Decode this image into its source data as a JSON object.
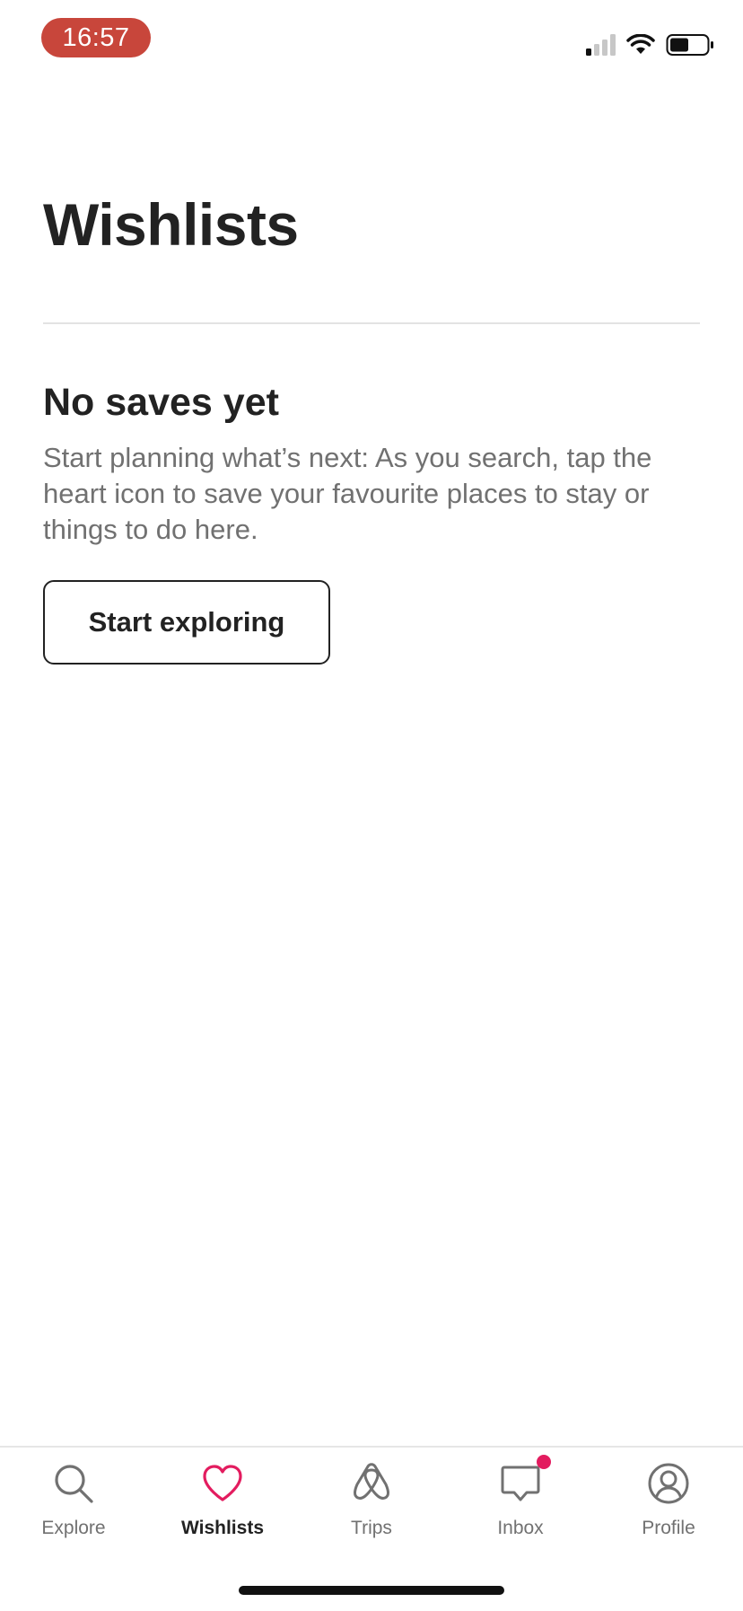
{
  "status_bar": {
    "time": "16:57",
    "icons": [
      "signal-icon",
      "wifi-icon",
      "battery-icon"
    ]
  },
  "header": {
    "title": "Wishlists"
  },
  "empty_state": {
    "heading": "No saves yet",
    "body": "Start planning what’s next: As you search, tap the heart icon to save your favourite places to stay or things to do here.",
    "button_label": "Start exploring"
  },
  "tab_bar": {
    "tabs": [
      {
        "label": "Explore",
        "icon": "search-icon",
        "active": false
      },
      {
        "label": "Wishlists",
        "icon": "heart-icon",
        "active": true
      },
      {
        "label": "Trips",
        "icon": "airbnb-logo-icon",
        "active": false
      },
      {
        "label": "Inbox",
        "icon": "message-icon",
        "active": false,
        "notification": true
      },
      {
        "label": "Profile",
        "icon": "profile-icon",
        "active": false
      }
    ]
  },
  "colors": {
    "accent": "#e31c5f",
    "text_primary": "#222222",
    "text_secondary": "#717171",
    "time_pill": "#c8463b"
  }
}
